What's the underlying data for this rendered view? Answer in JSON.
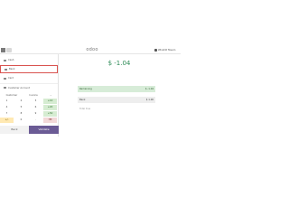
{
  "topbar": {
    "back_label": "",
    "logo_text": "odoo",
    "store_label": "Winshill Tavern"
  },
  "payment_methods": {
    "cash": {
      "label": "Cash",
      "icon": "cash-icon"
    },
    "bank": {
      "label": "Bank",
      "icon": "bank-icon"
    },
    "card": {
      "label": "Card",
      "icon": "card-icon"
    },
    "customer": {
      "label": "Customer Account",
      "icon": "customer-icon"
    }
  },
  "actions": {
    "customer": "Customer",
    "invoice": "Invoice",
    "more": "..."
  },
  "keypad": {
    "rows": [
      [
        "1",
        "2",
        "3",
        "+10"
      ],
      [
        "4",
        "5",
        "6",
        "+20"
      ],
      [
        "7",
        "8",
        "9",
        "+50"
      ],
      [
        "+/-",
        "0",
        ".",
        "⌫"
      ]
    ]
  },
  "footer": {
    "back": "Back",
    "validate": "Validate"
  },
  "amount_due": "$ -1.04",
  "payment_lines": [
    {
      "left": "Remaining",
      "right": "$ -1.04",
      "style": "hl"
    },
    {
      "left": "Bank",
      "right": "$ 1.00",
      "style": "sel"
    },
    {
      "left": "Total Due",
      "right": "",
      "style": "info"
    }
  ],
  "colors": {
    "validate": "#6b5b95",
    "due_green": "#2e8b57",
    "highlight": "#d7ecd8"
  }
}
